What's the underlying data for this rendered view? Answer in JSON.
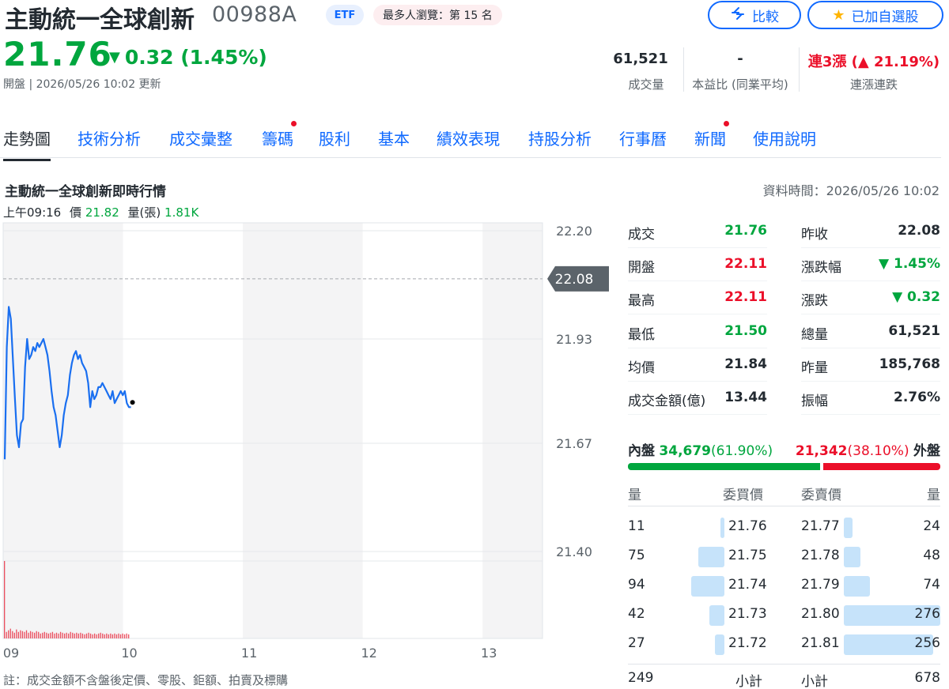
{
  "header": {
    "title": "主動統一全球創新",
    "ticker": "00988A",
    "etf_badge": "ETF",
    "rank_badge": "最多人瀏覽：第 15 名",
    "compare_label": "比較",
    "watch_label": "已加自選股",
    "price": "21.76",
    "change": "0.32 (1.45%)",
    "status": "開盤 | 2026/05/26 10:02 更新"
  },
  "kpis": [
    {
      "value": "61,521",
      "label": "成交量"
    },
    {
      "value": "-",
      "label": "本益比 (同業平均)"
    },
    {
      "value": "連3漲 (▲ 21.19%)",
      "label": "連漲連跌"
    }
  ],
  "tabs": [
    {
      "label": "走勢圖",
      "active": true,
      "dot": false
    },
    {
      "label": "技術分析",
      "dot": false
    },
    {
      "label": "成交彙整",
      "dot": false
    },
    {
      "label": "籌碼",
      "dot": true
    },
    {
      "label": "股利",
      "dot": false
    },
    {
      "label": "基本",
      "dot": false
    },
    {
      "label": "績效表現",
      "dot": false
    },
    {
      "label": "持股分析",
      "dot": false
    },
    {
      "label": "行事曆",
      "dot": false
    },
    {
      "label": "新聞",
      "dot": true
    },
    {
      "label": "使用說明",
      "dot": false
    }
  ],
  "section": {
    "title": "主動統一全球創新即時行情",
    "data_time": "資料時間：2026/05/26 10:02",
    "hover_time": "上午09:16",
    "hover_price_label": "價",
    "hover_price": "21.82",
    "hover_vol_label": "量(張)",
    "hover_vol": "1.81K",
    "note": "註：成交金額不含盤後定價、零股、鉅額、拍賣及標購"
  },
  "chart_data": {
    "type": "line",
    "title": "",
    "xlabel": "",
    "ylabel": "",
    "x_ticks": [
      "09",
      "10",
      "11",
      "12",
      "13"
    ],
    "y_ticks": [
      "22.20",
      "21.93",
      "21.67",
      "21.40"
    ],
    "ylim": [
      21.4,
      22.2
    ],
    "reference_line": {
      "label": "22.08",
      "value": 22.08
    },
    "series": [
      {
        "x": [
          "09:00",
          "09:01",
          "09:02",
          "09:03",
          "09:04",
          "09:05",
          "09:06",
          "09:07",
          "09:08",
          "09:09",
          "09:10",
          "09:11",
          "09:12",
          "09:13",
          "09:14",
          "09:15",
          "09:16",
          "09:17",
          "09:18",
          "09:19",
          "09:20",
          "09:21",
          "09:22",
          "09:23",
          "09:24",
          "09:25",
          "09:26",
          "09:27",
          "09:28",
          "09:29",
          "09:30",
          "09:31",
          "09:32",
          "09:33",
          "09:34",
          "09:35",
          "09:36",
          "09:37",
          "09:38",
          "09:39",
          "09:40",
          "09:41",
          "09:42",
          "09:43",
          "09:44",
          "09:45",
          "09:46",
          "09:47",
          "09:48",
          "09:49",
          "09:50",
          "09:51",
          "09:52",
          "09:53",
          "09:54",
          "09:55",
          "09:56",
          "09:57",
          "09:58",
          "09:59",
          "10:00",
          "10:01",
          "10:02"
        ],
        "y": [
          21.63,
          21.91,
          22.01,
          21.98,
          21.88,
          21.78,
          21.69,
          21.66,
          21.72,
          21.73,
          21.86,
          21.93,
          21.88,
          21.89,
          21.91,
          21.9,
          21.92,
          21.91,
          21.92,
          21.93,
          21.91,
          21.89,
          21.85,
          21.8,
          21.76,
          21.74,
          21.7,
          21.66,
          21.69,
          21.74,
          21.77,
          21.79,
          21.84,
          21.87,
          21.89,
          21.9,
          21.88,
          21.89,
          21.87,
          21.86,
          21.85,
          21.82,
          21.76,
          21.8,
          21.78,
          21.79,
          21.81,
          21.81,
          21.82,
          21.81,
          21.8,
          21.79,
          21.78,
          21.8,
          21.77,
          21.78,
          21.79,
          21.8,
          21.79,
          21.8,
          21.77,
          21.76,
          21.76
        ]
      }
    ],
    "volume": [
      11,
      8,
      10,
      12,
      9,
      7,
      11,
      8,
      10,
      9,
      8,
      10,
      7,
      9,
      8,
      7,
      9,
      8,
      6,
      7,
      8,
      7,
      6,
      7,
      8,
      6,
      7,
      6,
      8,
      7,
      6,
      7,
      6,
      8,
      7,
      6,
      7,
      6,
      7,
      6,
      5,
      6,
      7,
      6,
      5,
      6,
      5,
      6,
      7,
      6,
      5,
      6,
      5,
      6,
      5,
      6,
      5,
      6,
      5,
      6,
      5,
      6,
      5
    ],
    "volume_first_bar": 95,
    "grid": true
  },
  "stats": {
    "left": [
      {
        "label": "成交",
        "value": "21.76",
        "color": "green"
      },
      {
        "label": "開盤",
        "value": "22.11",
        "color": "red"
      },
      {
        "label": "最高",
        "value": "22.11",
        "color": "red"
      },
      {
        "label": "最低",
        "value": "21.50",
        "color": "green"
      },
      {
        "label": "均價",
        "value": "21.84",
        "color": "black"
      },
      {
        "label": "成交金額(億)",
        "value": "13.44",
        "color": "black"
      }
    ],
    "right": [
      {
        "label": "昨收",
        "value": "22.08",
        "color": "black"
      },
      {
        "label": "漲跌幅",
        "value": "▼ 1.45%",
        "color": "green"
      },
      {
        "label": "漲跌",
        "value": "▼ 0.32",
        "color": "green"
      },
      {
        "label": "總量",
        "value": "61,521",
        "color": "black"
      },
      {
        "label": "昨量",
        "value": "185,768",
        "color": "black"
      },
      {
        "label": "振幅",
        "value": "2.76%",
        "color": "black"
      }
    ]
  },
  "inout": {
    "in_label": "內盤",
    "in_value": "34,679",
    "in_pct": "(61.90%)",
    "in_fraction": 0.619,
    "out_value": "21,342",
    "out_pct": "(38.10%)",
    "out_label": "外盤"
  },
  "orderbook": {
    "headers": {
      "vol": "量",
      "bid": "委買價",
      "ask": "委賣價",
      "vol2": "量"
    },
    "rows": [
      {
        "bid_vol": "11",
        "bid": "21.76",
        "ask": "21.77",
        "ask_vol": "24",
        "bid_n": 11,
        "ask_n": 24
      },
      {
        "bid_vol": "75",
        "bid": "21.75",
        "ask": "21.78",
        "ask_vol": "48",
        "bid_n": 75,
        "ask_n": 48
      },
      {
        "bid_vol": "94",
        "bid": "21.74",
        "ask": "21.79",
        "ask_vol": "74",
        "bid_n": 94,
        "ask_n": 74
      },
      {
        "bid_vol": "42",
        "bid": "21.73",
        "ask": "21.80",
        "ask_vol": "276",
        "bid_n": 42,
        "ask_n": 276
      },
      {
        "bid_vol": "27",
        "bid": "21.72",
        "ask": "21.81",
        "ask_vol": "256",
        "bid_n": 27,
        "ask_n": 256
      }
    ],
    "bid_total": "249",
    "bid_total_label": "小計",
    "ask_total_label": "小計",
    "ask_total": "678"
  }
}
